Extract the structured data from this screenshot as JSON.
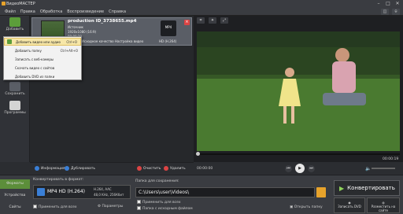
{
  "window": {
    "title": "ВидеоМАСТЕР"
  },
  "menu": [
    "Файл",
    "Правка",
    "Обработка",
    "Воспроизведение",
    "Справка"
  ],
  "left_tools": [
    {
      "label": "Добавить",
      "icon": "add-icon",
      "color": "#5c9e3a"
    },
    {
      "label": "Сохранить",
      "icon": "save-icon",
      "color": "#5a5e66"
    },
    {
      "label": "Программы",
      "icon": "programs-icon",
      "color": "#d4d4d4"
    }
  ],
  "file_item": {
    "name": "production ID_3738655.mp4",
    "line1": "Источник",
    "line2": "1920x1080 (16:9)",
    "line3": "00:00:20",
    "quality": "Исходное качество",
    "settings": "Настройка видео",
    "format_badge": "MP4",
    "format_sub": "HD (H.264)"
  },
  "dropdown": [
    {
      "label": "Добавить видео или аудио",
      "shortcut": "Ctrl+O",
      "highlight": true
    },
    {
      "label": "Добавить папку",
      "shortcut": "Ctrl+Alt+O",
      "highlight": false
    },
    {
      "label": "Записать с веб-камеры",
      "shortcut": "",
      "highlight": false
    },
    {
      "label": "Скачать видео с сайтов",
      "shortcut": "",
      "highlight": false
    },
    {
      "label": "Добавить DVD из папки",
      "shortcut": "",
      "highlight": false
    }
  ],
  "player": {
    "time_current": "00:00:00",
    "time_total": "00:00:19"
  },
  "list_toolbar": [
    {
      "label": "Информация",
      "color": "#3a7fd6"
    },
    {
      "label": "Дублировать",
      "color": "#3a7fd6"
    },
    {
      "label": "Очистить",
      "color": "#d44"
    },
    {
      "label": "Удалить",
      "color": "#d44"
    }
  ],
  "bottom": {
    "tabs": [
      "Форматы",
      "Устройства",
      "Сайты"
    ],
    "convert_label": "Конвертировать в формат:",
    "format_name": "MP4 HD (H.264)",
    "format_spec1": "H.264, AAC",
    "format_spec2": "48,0 KHz, 256Кбит",
    "apply_all": "Применить для всех",
    "params": "Параметры",
    "save_folder_label": "Папка для сохранения:",
    "save_path": "C:\\Users\\user\\Videos\\",
    "apply_all2": "Применить для всех",
    "source_folder": "Папка с исходным файлом",
    "open_folder": "Открыть папку",
    "convert_btn": "Конвертировать",
    "burn_dvd": "Записать DVD",
    "publish": "Разместить на сайте"
  }
}
